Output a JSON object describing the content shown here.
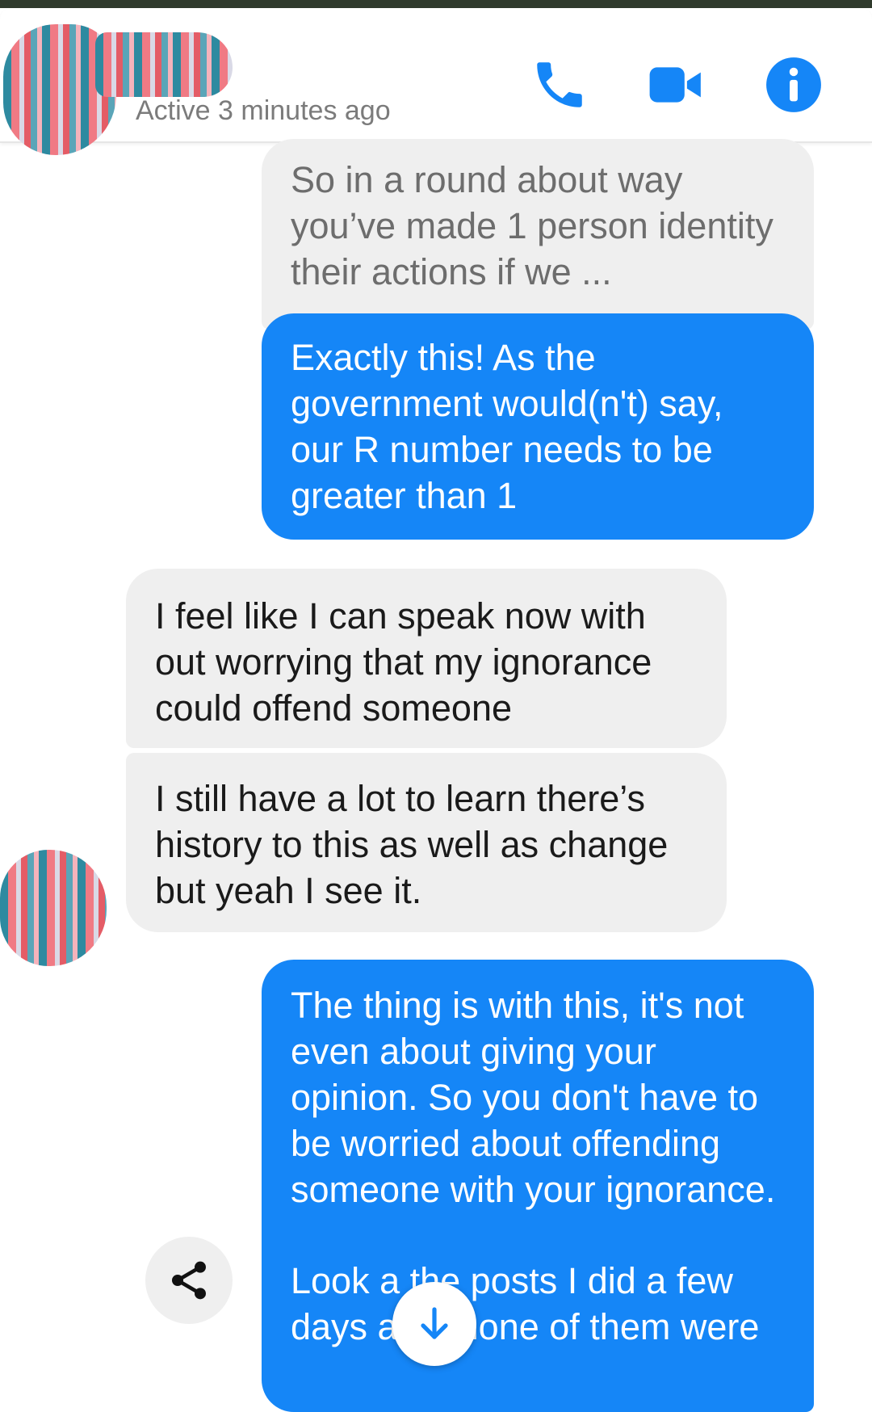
{
  "header": {
    "status": "Active 3 minutes ago"
  },
  "messages": [
    {
      "sender": "other",
      "text": "So in a round about way you’ve made 1 person identity their actions if we ..."
    },
    {
      "sender": "me",
      "text": "Exactly this! As the government would(n't) say, our R number needs to be greater than 1"
    },
    {
      "sender": "other",
      "text": "I feel like I can speak now with out worrying that my ignorance could offend someone"
    },
    {
      "sender": "other",
      "text": "I still have a lot to learn there’s history to this as well as change but yeah I see it."
    },
    {
      "sender": "me",
      "paragraphs": [
        "The thing is with this, it's not even about giving your opinion. So you don't have to be worried about offending someone with your ignorance.",
        "Look a the posts I did a few days ago, none of them were"
      ]
    }
  ],
  "icons": {
    "call": "phone-icon",
    "video": "video-camera-icon",
    "info": "info-icon",
    "share": "share-icon",
    "scroll": "arrow-down-icon"
  },
  "colors": {
    "accent": "#1586f7",
    "incoming_bubble": "#efefef",
    "status_text": "#7b7b7b"
  }
}
